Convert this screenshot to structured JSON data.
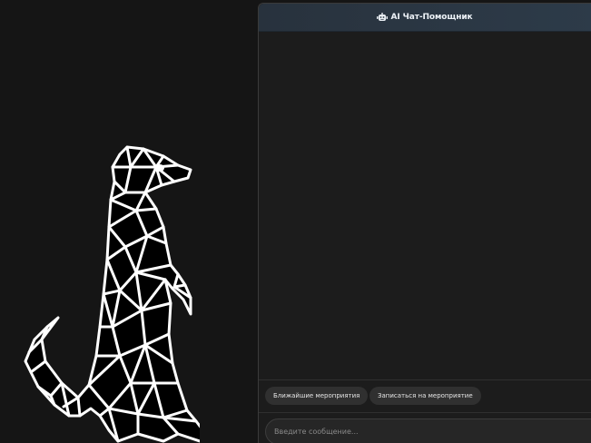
{
  "chat": {
    "title": "AI Чат-Помощник",
    "header_icon": "robot-icon",
    "quick_actions": [
      {
        "label": "Ближайшие мероприятия"
      },
      {
        "label": "Записаться на мероприятие"
      }
    ],
    "input": {
      "placeholder": "Введите сообщение...",
      "value": ""
    }
  },
  "colors": {
    "page_background": "#151515",
    "panel_background": "#1c1c1c",
    "header_background": "#2b3744",
    "button_background": "#303030",
    "illustration_stroke": "#ffffff"
  },
  "illustration": {
    "subject": "meerkat-line-art"
  }
}
